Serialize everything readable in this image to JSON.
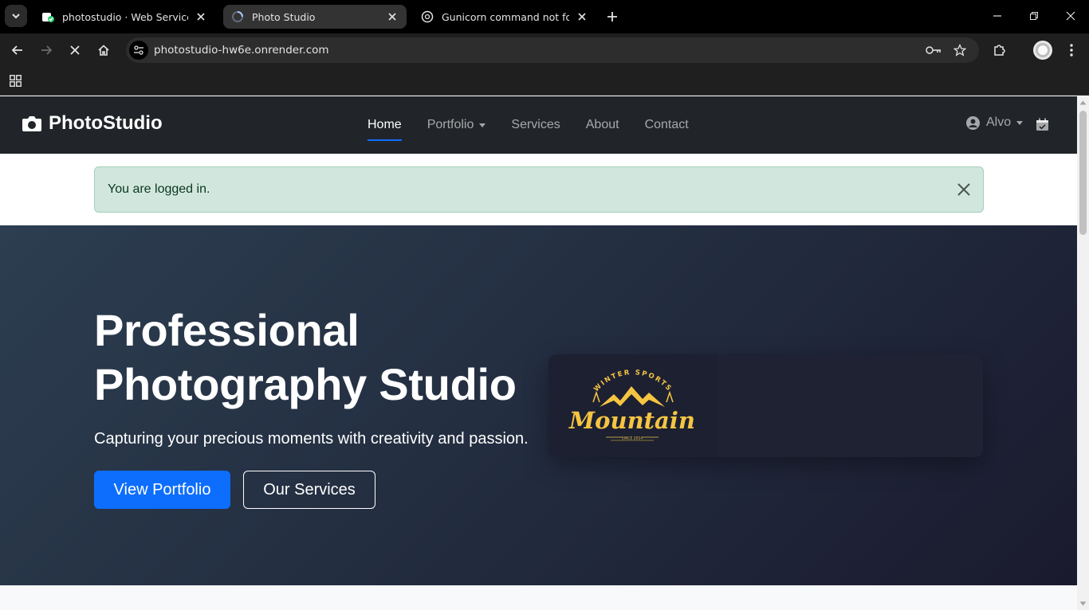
{
  "browser": {
    "tabs": [
      {
        "label": "photostudio · Web Service · Re",
        "active": false
      },
      {
        "label": "Photo Studio",
        "active": true
      },
      {
        "label": "Gunicorn command not found",
        "active": false
      }
    ],
    "url": "photostudio-hw6e.onrender.com"
  },
  "navbar": {
    "brand": "PhotoStudio",
    "links": [
      {
        "label": "Home",
        "active": true
      },
      {
        "label": "Portfolio",
        "dropdown": true
      },
      {
        "label": "Services"
      },
      {
        "label": "About"
      },
      {
        "label": "Contact"
      }
    ],
    "user": "Alvo"
  },
  "alert": {
    "message": "You are logged in."
  },
  "hero": {
    "title": "Professional Photography Studio",
    "lead": "Capturing your precious moments with creativity and passion.",
    "primary_button": "View Portfolio",
    "secondary_button": "Our Services",
    "logo": {
      "arc_text": "WINTER SPORTS",
      "word": "Mountain",
      "since": "SINCE 2014"
    }
  },
  "colors": {
    "accent": "#0d6efd",
    "navbar": "#212529",
    "alert_bg": "#d1e7dd",
    "logo": "#f5c542"
  }
}
